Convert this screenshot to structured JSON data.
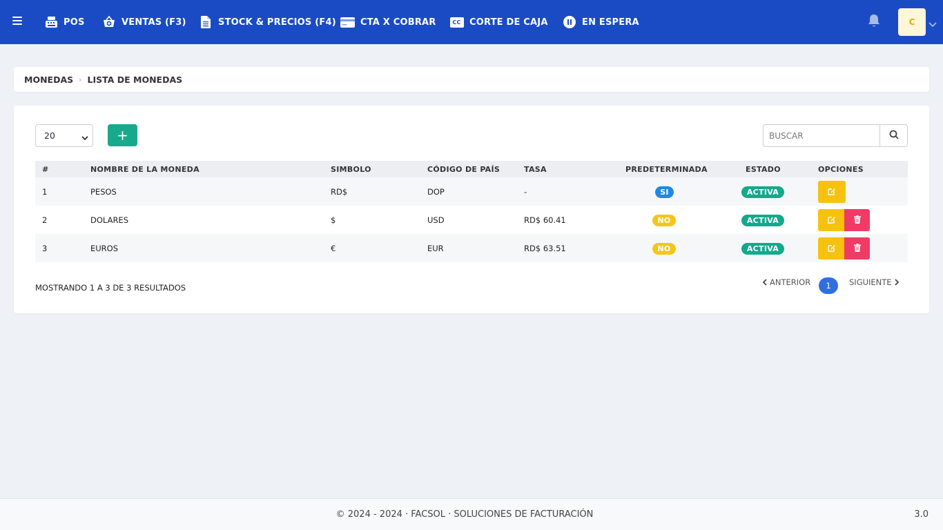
{
  "nav": {
    "items": [
      {
        "label": "POS",
        "icon": "cash-register-icon"
      },
      {
        "label": "VENTAS (F3)",
        "icon": "basket-plus-icon"
      },
      {
        "label": "STOCK & PRECIOS (F4)",
        "icon": "document-icon"
      },
      {
        "label": "CTA X COBRAR",
        "icon": "credit-card-icon"
      },
      {
        "label": "CORTE DE CAJA",
        "icon": "cc-icon"
      },
      {
        "label": "EN ESPERA",
        "icon": "pause-icon"
      }
    ],
    "avatar_initial": "C",
    "cc_icon_text": "CC"
  },
  "breadcrumb": {
    "parent": "MONEDAS",
    "current": "LISTA DE MONEDAS"
  },
  "toolbar": {
    "page_size": "20",
    "add_label": "+",
    "search_placeholder": "BUSCAR"
  },
  "table": {
    "headers": {
      "num": "#",
      "name": "NOMBRE DE LA MONEDA",
      "symbol": "SIMBOLO",
      "country": "CÓDIGO DE PAÍS",
      "rate": "TASA",
      "default": "PREDETERMINADA",
      "status": "ESTADO",
      "options": "OPCIONES"
    },
    "rows": [
      {
        "num": "1",
        "name": "PESOS",
        "symbol": "RD$",
        "country": "DOP",
        "rate": "-",
        "default": "SI",
        "status": "ACTIVA"
      },
      {
        "num": "2",
        "name": "DOLARES",
        "symbol": "$",
        "country": "USD",
        "rate": "RD$ 60.41",
        "default": "NO",
        "status": "ACTIVA"
      },
      {
        "num": "3",
        "name": "EUROS",
        "symbol": "€",
        "country": "EUR",
        "rate": "RD$ 63.51",
        "default": "NO",
        "status": "ACTIVA"
      }
    ]
  },
  "pagination": {
    "summary": "MOSTRANDO 1 A 3 DE 3 RESULTADOS",
    "prev": "ANTERIOR",
    "current": "1",
    "next": "SIGUIENTE"
  },
  "footer": {
    "text": "© 2024 - 2024 · FACSOL · SOLUCIONES DE FACTURACIÓN",
    "version": "3.0"
  },
  "colors": {
    "navbar": "#1b4bc4",
    "add_button": "#17a98c",
    "badge_si": "#1e88e5",
    "badge_no": "#f5c518",
    "badge_activa": "#14a88c",
    "edit_button": "#f6c20f",
    "delete_button": "#ef3b66",
    "page_current": "#2f6fe0"
  }
}
